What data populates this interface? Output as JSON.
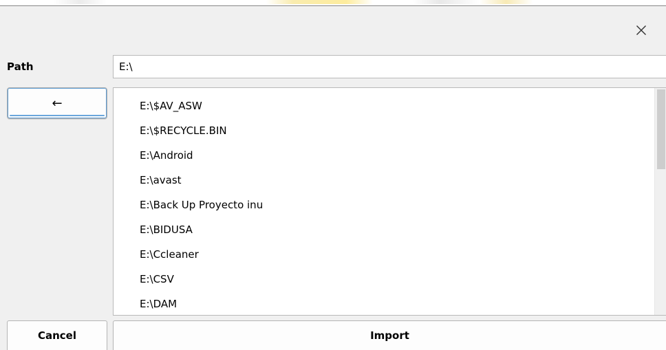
{
  "dialog": {
    "close_icon": "close-icon",
    "path_label": "Path",
    "path_value": "E:\\",
    "back_label": "←",
    "cancel_label": "Cancel",
    "import_label": "Import"
  },
  "directory_list": {
    "items": [
      "E:\\$AV_ASW",
      "E:\\$RECYCLE.BIN",
      "E:\\Android",
      "E:\\avast",
      "E:\\Back Up Proyecto inu",
      "E:\\BIDUSA",
      "E:\\Ccleaner",
      "E:\\CSV",
      "E:\\DAM"
    ],
    "scroll_position": 0
  },
  "colors": {
    "background": "#f0f0f0",
    "focus_outline": "#5e9ed6",
    "scroll_thumb": "#cdcdcd"
  }
}
